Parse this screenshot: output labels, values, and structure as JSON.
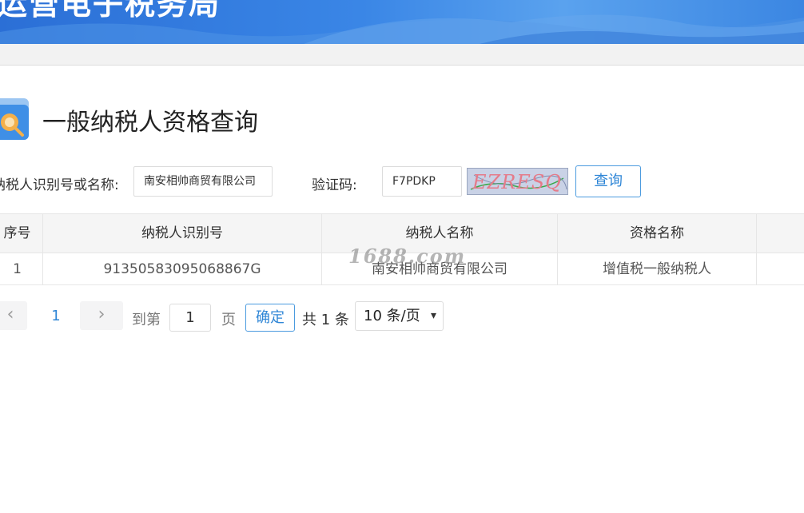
{
  "banner": {
    "title": "运营电子税务局"
  },
  "page": {
    "title": "一般纳税人资格查询"
  },
  "form": {
    "taxpayer_label": "纳税人识别号或名称:",
    "taxpayer_value": "南安相帅商贸有限公司",
    "captcha_label": "验证码:",
    "captcha_value": "F7PDKP",
    "captcha_image_text": "EZRESQ",
    "query_button": "查询"
  },
  "table": {
    "columns": [
      "序号",
      "纳税人识别号",
      "纳税人名称",
      "资格名称",
      ""
    ],
    "rows": [
      [
        "1",
        "91350583095068867G",
        "南安相帅商贸有限公司",
        "增值税一般纳税人",
        ""
      ]
    ]
  },
  "watermark": "1688.com",
  "pagination": {
    "prev_icon": "chevron-left-icon",
    "next_icon": "chevron-right-icon",
    "current_page": "1",
    "goto_label": "到第",
    "goto_value": "1",
    "page_label": "页",
    "confirm_button": "确定",
    "total_text": "共 1 条",
    "page_size": "10 条/页"
  },
  "colors": {
    "banner_blue": "#3a86e6",
    "accent_blue": "#2f86d6",
    "header_bg": "#f5f5f5"
  }
}
